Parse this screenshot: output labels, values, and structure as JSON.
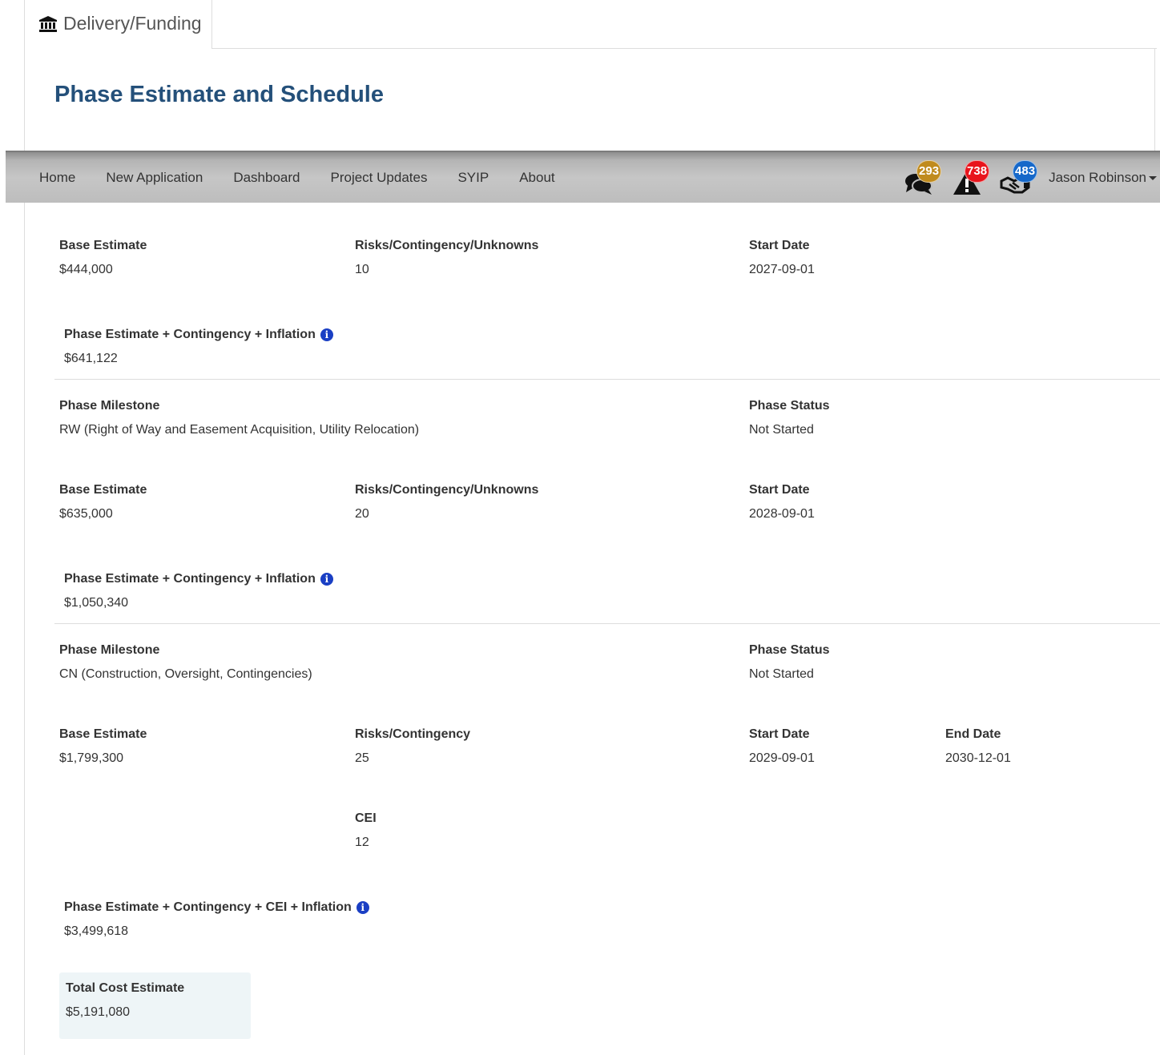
{
  "tab": {
    "label": "Delivery/Funding",
    "icon": "bank-icon"
  },
  "page_title": "Phase Estimate and Schedule",
  "navbar": {
    "links": [
      "Home",
      "New Application",
      "Dashboard",
      "Project Updates",
      "SYIP",
      "About"
    ],
    "icons": [
      {
        "name": "comments-icon",
        "badge": "293",
        "badge_color": "#c08b1e"
      },
      {
        "name": "warning-icon",
        "badge": "738",
        "badge_color": "#e8141c"
      },
      {
        "name": "handshake-icon",
        "badge": "483",
        "badge_color": "#1668c9"
      }
    ],
    "user": "Jason Robinson"
  },
  "phase1": {
    "base_estimate_label": "Base Estimate",
    "base_estimate": "$444,000",
    "risks_label": "Risks/Contingency/Unknowns",
    "risks": "10",
    "start_date_label": "Start Date",
    "start_date": "2027-09-01",
    "total_label": "Phase Estimate + Contingency + Inflation",
    "total": "$641,122"
  },
  "phase2": {
    "milestone_label": "Phase Milestone",
    "milestone": "RW (Right of Way and Easement Acquisition, Utility Relocation)",
    "status_label": "Phase Status",
    "status": "Not Started",
    "base_estimate_label": "Base Estimate",
    "base_estimate": "$635,000",
    "risks_label": "Risks/Contingency/Unknowns",
    "risks": "20",
    "start_date_label": "Start Date",
    "start_date": "2028-09-01",
    "total_label": "Phase Estimate + Contingency + Inflation",
    "total": "$1,050,340"
  },
  "phase3": {
    "milestone_label": "Phase Milestone",
    "milestone": "CN (Construction, Oversight, Contingencies)",
    "status_label": "Phase Status",
    "status": "Not Started",
    "base_estimate_label": "Base Estimate",
    "base_estimate": "$1,799,300",
    "risks_label": "Risks/Contingency",
    "risks": "25",
    "start_date_label": "Start Date",
    "start_date": "2029-09-01",
    "end_date_label": "End Date",
    "end_date": "2030-12-01",
    "cei_label": "CEI",
    "cei": "12",
    "total_label": "Phase Estimate + Contingency + CEI + Inflation",
    "total": "$3,499,618"
  },
  "total_cost": {
    "label": "Total Cost Estimate",
    "value": "$5,191,080"
  },
  "info_glyph": "i"
}
